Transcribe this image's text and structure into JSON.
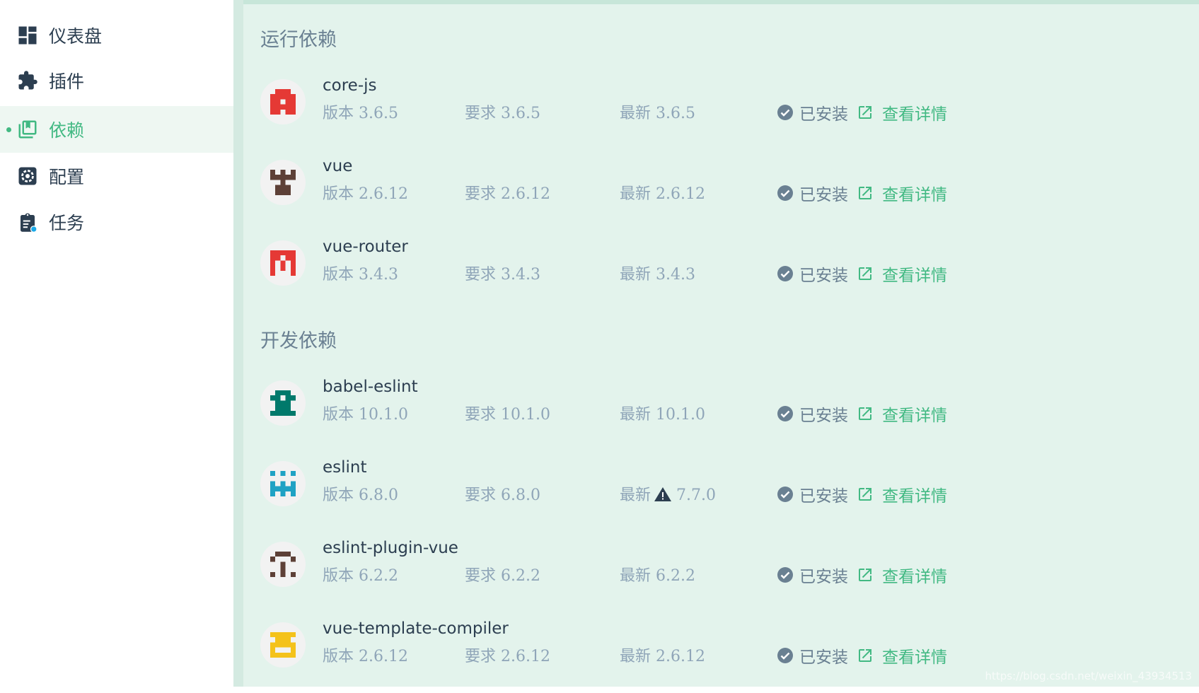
{
  "sidebar": {
    "items": [
      {
        "label": "仪表盘",
        "icon": "dashboard-icon",
        "active": false
      },
      {
        "label": "插件",
        "icon": "puzzle-icon",
        "active": false
      },
      {
        "label": "依赖",
        "icon": "library-books-icon",
        "active": true
      },
      {
        "label": "配置",
        "icon": "gear-icon",
        "active": false
      },
      {
        "label": "任务",
        "icon": "clipboard-task-icon",
        "active": false
      }
    ]
  },
  "sections": {
    "runtime": {
      "title": "运行依赖",
      "deps": [
        {
          "name": "core-js",
          "version_label": "版本",
          "version": "3.6.5",
          "required_label": "要求",
          "required": "3.6.5",
          "latest_label": "最新",
          "latest": "3.6.5",
          "status": "已安装",
          "details": "查看详情",
          "avatar_color": "#e53935"
        },
        {
          "name": "vue",
          "version_label": "版本",
          "version": "2.6.12",
          "required_label": "要求",
          "required": "2.6.12",
          "latest_label": "最新",
          "latest": "2.6.12",
          "status": "已安装",
          "details": "查看详情",
          "avatar_color": "#5d4037"
        },
        {
          "name": "vue-router",
          "version_label": "版本",
          "version": "3.4.3",
          "required_label": "要求",
          "required": "3.4.3",
          "latest_label": "最新",
          "latest": "3.4.3",
          "status": "已安装",
          "details": "查看详情",
          "avatar_color": "#e53935"
        }
      ]
    },
    "dev": {
      "title": "开发依赖",
      "deps": [
        {
          "name": "babel-eslint",
          "version_label": "版本",
          "version": "10.1.0",
          "required_label": "要求",
          "required": "10.1.0",
          "latest_label": "最新",
          "latest": "10.1.0",
          "status": "已安装",
          "details": "查看详情",
          "avatar_color": "#00796b"
        },
        {
          "name": "eslint",
          "version_label": "版本",
          "version": "6.8.0",
          "required_label": "要求",
          "required": "6.8.0",
          "latest_label": "最新",
          "latest": "7.7.0",
          "status": "已安装",
          "details": "查看详情",
          "avatar_color": "#1fa2c4",
          "update_warning": true
        },
        {
          "name": "eslint-plugin-vue",
          "version_label": "版本",
          "version": "6.2.2",
          "required_label": "要求",
          "required": "6.2.2",
          "latest_label": "最新",
          "latest": "6.2.2",
          "status": "已安装",
          "details": "查看详情",
          "avatar_color": "#5d4037"
        },
        {
          "name": "vue-template-compiler",
          "version_label": "版本",
          "version": "2.6.12",
          "required_label": "要求",
          "required": "2.6.12",
          "latest_label": "最新",
          "latest": "2.6.12",
          "status": "已安装",
          "details": "查看详情",
          "avatar_color": "#f4c21b"
        }
      ]
    }
  },
  "watermark": "https://blog.csdn.net/weixin_43934513",
  "colors": {
    "accent": "#42b983",
    "text": "#2c3e50",
    "muted": "#8fa5b8",
    "panel_bg": "#e3f3ec"
  }
}
